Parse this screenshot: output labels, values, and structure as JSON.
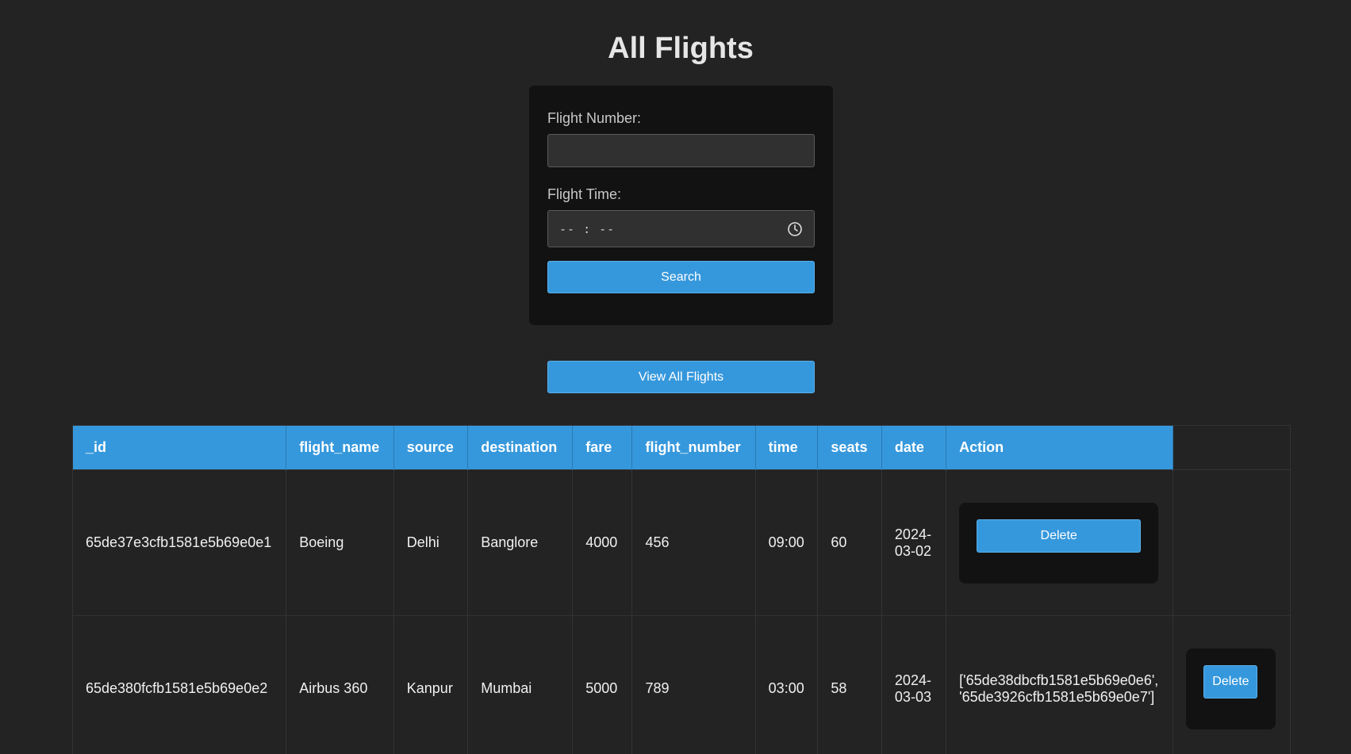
{
  "page": {
    "title": "All Flights"
  },
  "search": {
    "flight_number_label": "Flight Number:",
    "flight_number_value": "",
    "flight_time_label": "Flight Time:",
    "flight_time_placeholder": "-- : --",
    "search_button": "Search",
    "clock_icon": "clock-icon"
  },
  "view_all_button": "View All Flights",
  "colors": {
    "background": "#232324",
    "card": "#121212",
    "accent": "#3698dc"
  },
  "table": {
    "headers": [
      "_id",
      "flight_name",
      "source",
      "destination",
      "fare",
      "flight_number",
      "time",
      "seats",
      "date",
      "Action"
    ],
    "rows": [
      {
        "_id": "65de37e3cfb1581e5b69e0e1",
        "flight_name": "Boeing",
        "source": "Delhi",
        "destination": "Banglore",
        "fare": "4000",
        "flight_number": "456",
        "time": "09:00",
        "seats": "60",
        "date": "2024-03-02",
        "action_text": "",
        "delete_label": "Delete"
      },
      {
        "_id": "65de380fcfb1581e5b69e0e2",
        "flight_name": "Airbus 360",
        "source": "Kanpur",
        "destination": "Mumbai",
        "fare": "5000",
        "flight_number": "789",
        "time": "03:00",
        "seats": "58",
        "date": "2024-03-03",
        "action_text": "['65de38dbcfb1581e5b69e0e6', '65de3926cfb1581e5b69e0e7']",
        "delete_label": "Delete"
      }
    ]
  }
}
